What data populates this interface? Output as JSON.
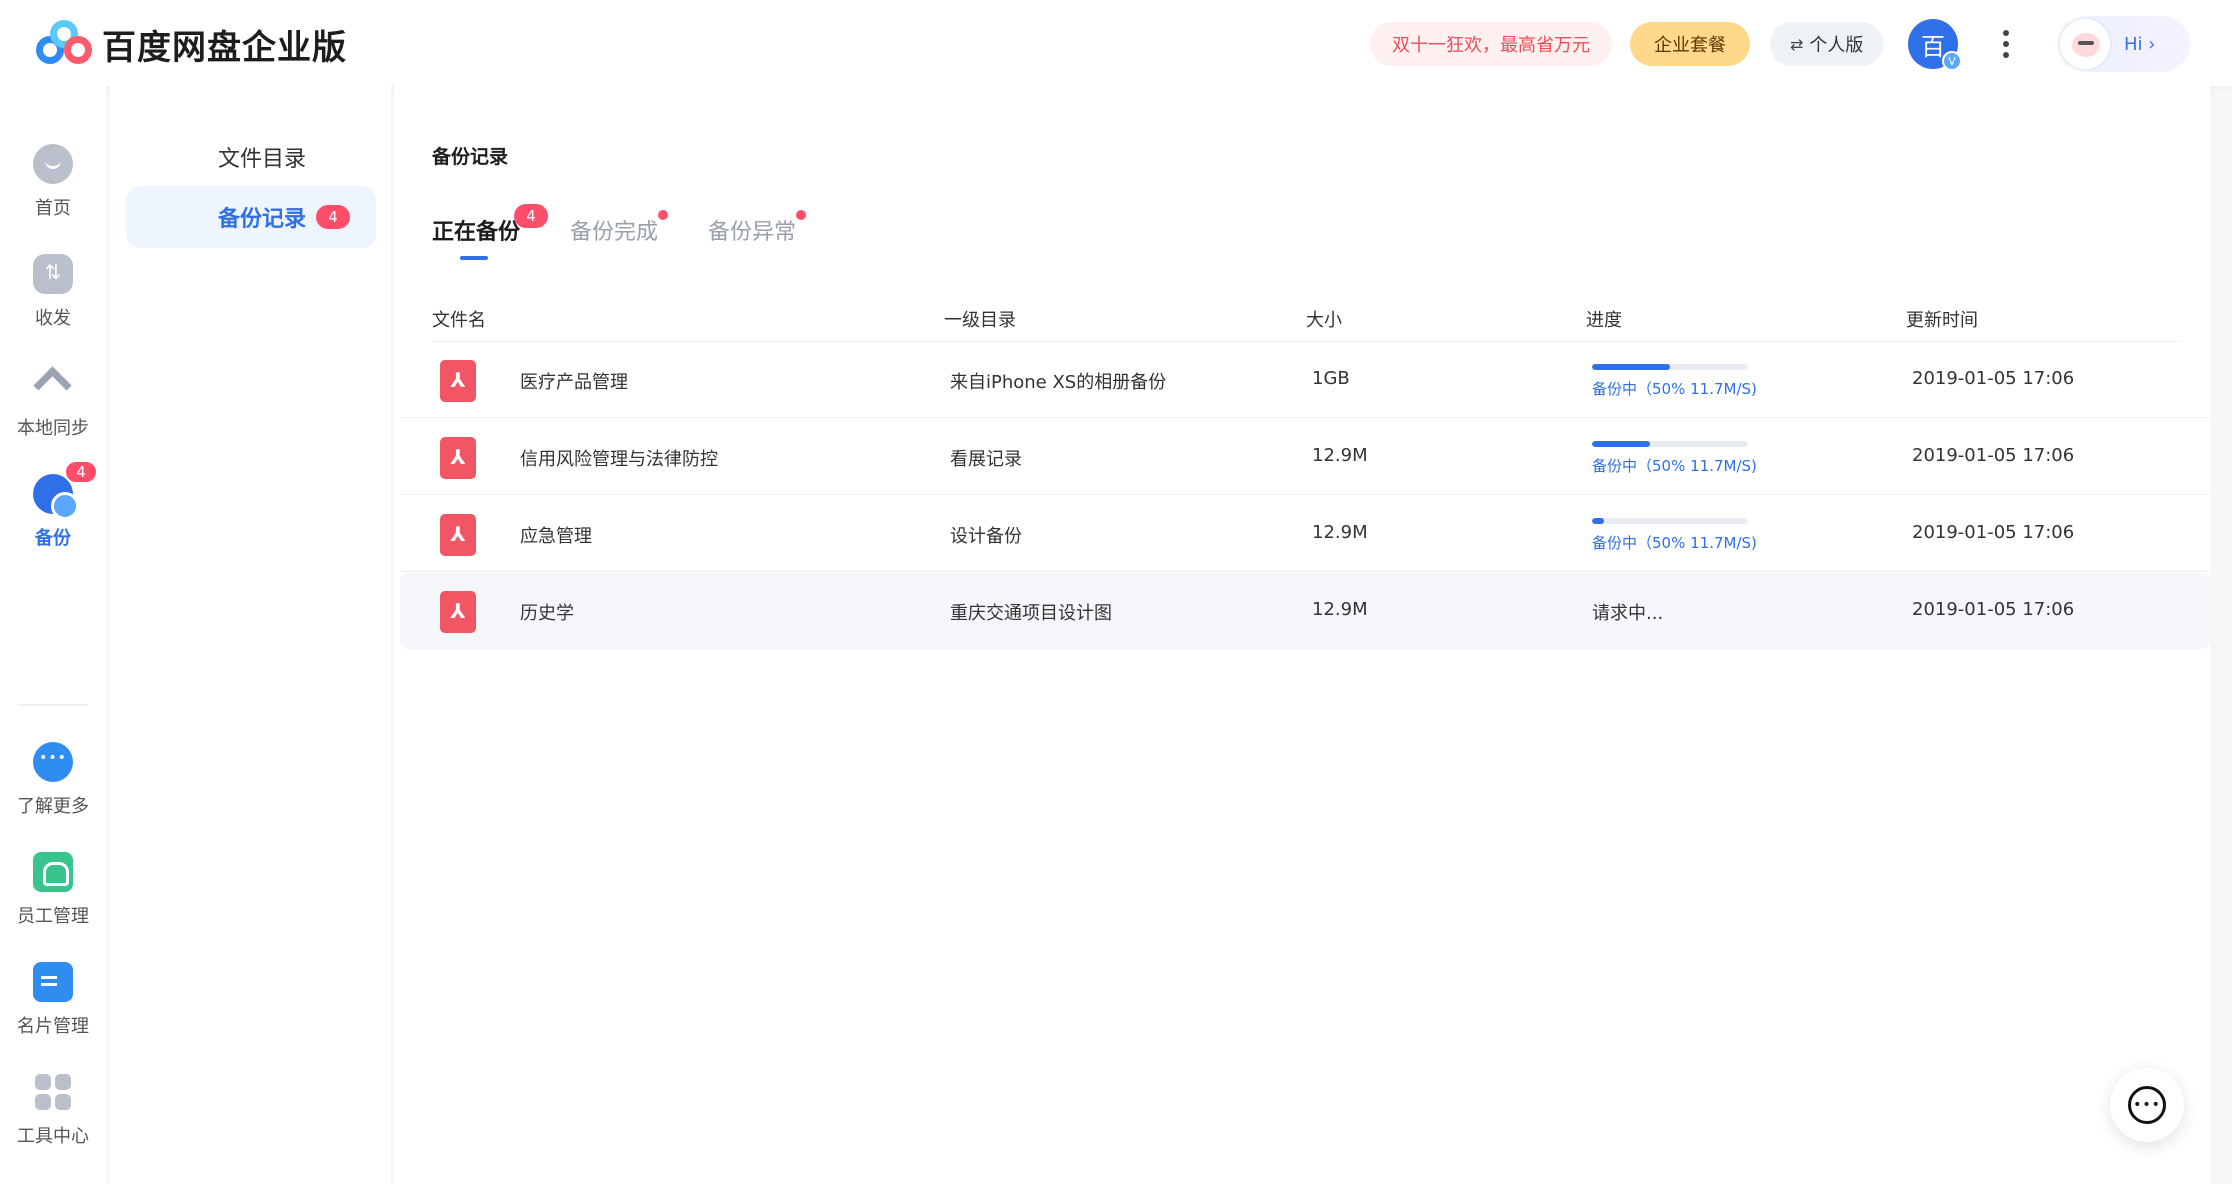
{
  "header": {
    "brand": "百度网盘企业版",
    "promo": "双十一狂欢，最高省万元",
    "suite": "企业套餐",
    "personal": "个人版",
    "avatar": "百",
    "avatar_badge": "V",
    "hi": "Hi ›"
  },
  "rail": {
    "items": [
      {
        "label": "首页",
        "icon": "home-icon"
      },
      {
        "label": "收发",
        "icon": "transfer-icon"
      },
      {
        "label": "本地同步",
        "icon": "sync-icon"
      },
      {
        "label": "备份",
        "icon": "backup-icon",
        "badge": "4",
        "active": true
      },
      {
        "label": "了解更多",
        "icon": "more-icon"
      },
      {
        "label": "员工管理",
        "icon": "staff-icon"
      },
      {
        "label": "名片管理",
        "icon": "card-icon"
      },
      {
        "label": "工具中心",
        "icon": "tools-icon"
      }
    ]
  },
  "subnav": {
    "items": [
      {
        "label": "文件目录"
      },
      {
        "label": "备份记录",
        "badge": "4",
        "active": true
      }
    ]
  },
  "main": {
    "title": "备份记录",
    "tabs": [
      {
        "label": "正在备份",
        "count": "4",
        "active": true
      },
      {
        "label": "备份完成",
        "dot": true
      },
      {
        "label": "备份异常",
        "dot": true
      }
    ],
    "columns": [
      "文件名",
      "一级目录",
      "大小",
      "进度",
      "更新时间"
    ],
    "rows": [
      {
        "name": "医疗产品管理",
        "dir": "来自iPhone XS的相册备份",
        "size": "1GB",
        "progress": 0.5,
        "progress_text": "备份中（50% 11.7M/S)",
        "time": "2019-01-05 17:06"
      },
      {
        "name": "信用风险管理与法律防控",
        "dir": "看展记录",
        "size": "12.9M",
        "progress": 0.37,
        "progress_text": "备份中（50% 11.7M/S)",
        "time": "2019-01-05 17:06"
      },
      {
        "name": "应急管理",
        "dir": "设计备份",
        "size": "12.9M",
        "progress": 0.08,
        "progress_text": "备份中（50% 11.7M/S)",
        "time": "2019-01-05 17:06"
      },
      {
        "name": "历史学",
        "dir": "重庆交通项目设计图",
        "size": "12.9M",
        "status": "请求中...",
        "time": "2019-01-05 17:06"
      }
    ]
  },
  "colors": {
    "accent": "#2f6fe8",
    "badge": "#ff4d6a",
    "file_icon": "#f25563"
  }
}
